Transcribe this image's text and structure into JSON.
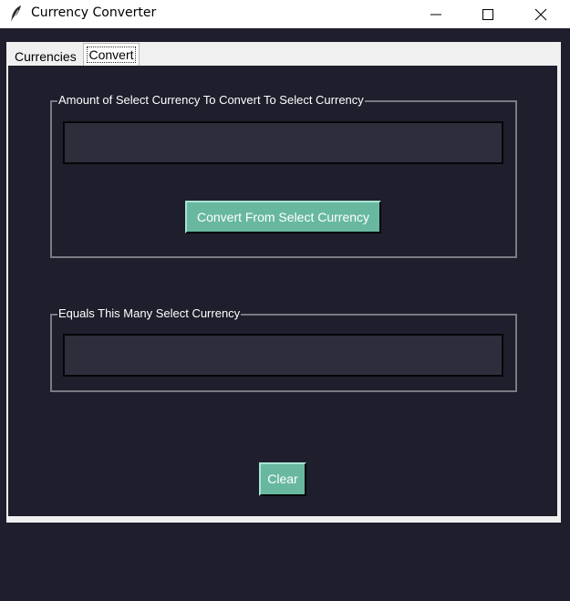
{
  "window": {
    "title": "Currency Converter",
    "icon": "feather-icon"
  },
  "tabs": [
    {
      "label": "Currencies",
      "selected": false
    },
    {
      "label": "Convert",
      "selected": true
    }
  ],
  "convert": {
    "amount_frame_title": "Amount of Select Currency To Convert To Select Currency",
    "amount_value": "",
    "convert_button_label": "Convert From Select Currency",
    "result_frame_title": "Equals This Many Select Currency",
    "result_value": "",
    "clear_button_label": "Clear"
  },
  "colors": {
    "background": "#1e1e2c",
    "entry_background": "#2e2d3b",
    "button": "#68b8a0",
    "notebook_frame": "#f0f0f0"
  }
}
